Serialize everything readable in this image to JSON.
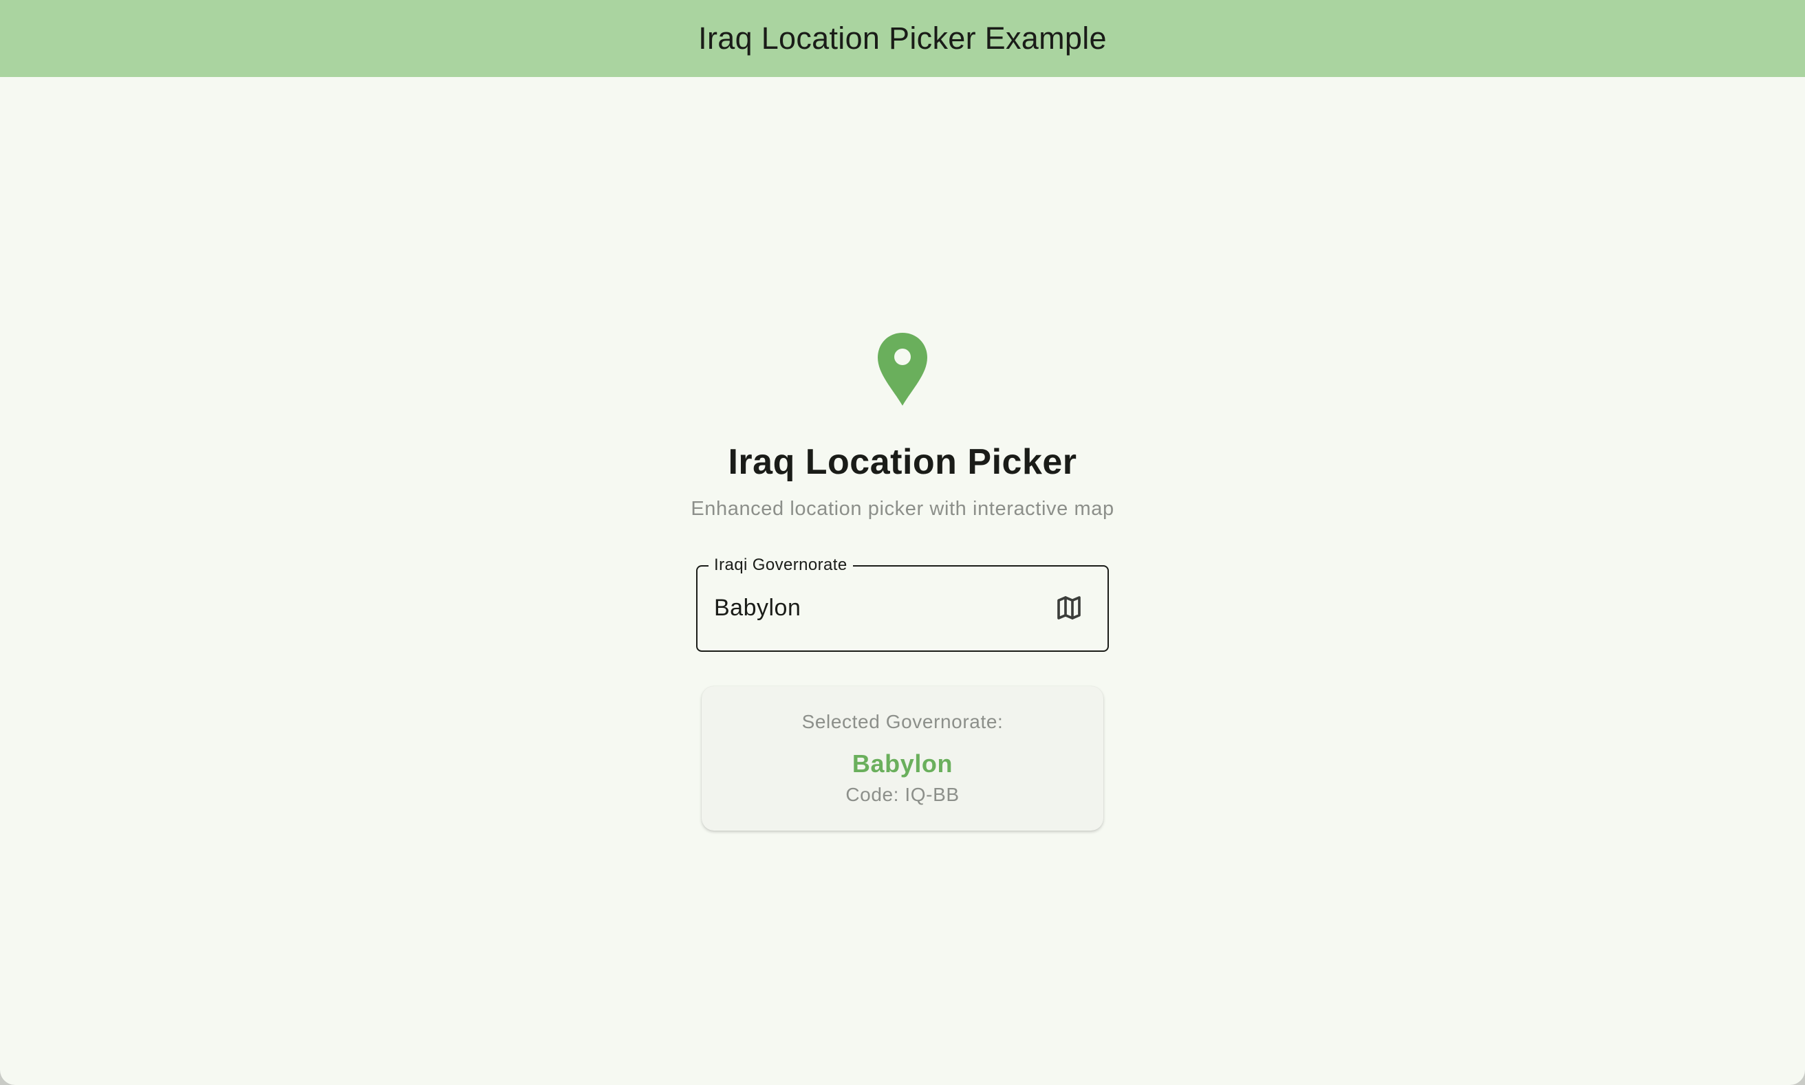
{
  "appbar": {
    "title": "Iraq Location Picker Example",
    "background_color": "#aad4a0"
  },
  "header": {
    "icon": "location-pin-icon",
    "icon_color": "#6aaf5c",
    "title": "Iraq Location Picker",
    "subtitle": "Enhanced location picker with interactive map"
  },
  "governorate_field": {
    "label": "Iraqi Governorate",
    "value": "Babylon",
    "trailing_icon": "map-icon"
  },
  "selection_card": {
    "heading": "Selected Governorate:",
    "name": "Babylon",
    "code_text": "Code: IQ-BB",
    "name_color": "#6aaf5c"
  },
  "colors": {
    "page_background": "#f6f9f2",
    "accent": "#6aaf5c"
  }
}
